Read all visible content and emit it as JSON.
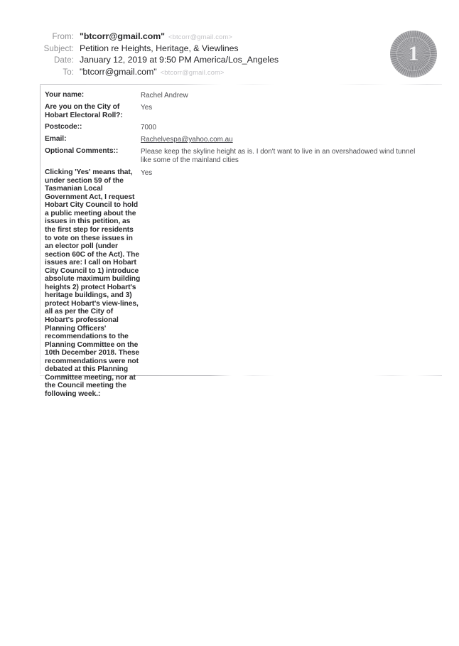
{
  "document": {
    "page_number": "1",
    "seal_name": "page-number-stamp"
  },
  "email_header": {
    "rows": [
      {
        "label": "From:",
        "value": "\"btcorr@gmail.com\"",
        "faint": "<btcorr@gmail.com>",
        "bold": true
      },
      {
        "label": "Subject:",
        "value": "Petition re Heights, Heritage, & Viewlines",
        "faint": "",
        "bold": false
      },
      {
        "label": "Date:",
        "value": "January 12, 2019 at 9:50 PM America/Los_Angeles",
        "faint": "",
        "bold": false
      },
      {
        "label": "To:",
        "value": "\"btcorr@gmail.com\"",
        "faint": "<btcorr@gmail.com>",
        "bold": false
      }
    ]
  },
  "form": {
    "fields": [
      {
        "label": "Your name:",
        "value": "Rachel Andrew",
        "is_link": false
      },
      {
        "label": "Are you on the City of Hobart Electoral Roll?:",
        "value": "Yes",
        "is_link": false
      },
      {
        "label": "Postcode::",
        "value": "7000",
        "is_link": false
      },
      {
        "label": "Email:",
        "value": "Rachelvespa@yahoo.com.au",
        "is_link": true
      },
      {
        "label": "Optional Comments::",
        "value": "Please keep the skyline height as is. I don't want to live in an overshadowed wind tunnel like some of the mainland cities",
        "is_link": false
      },
      {
        "label": "Clicking 'Yes' means that, under section 59 of the Tasmanian Local Government Act, I request Hobart City Council to hold a public meeting about the issues in this petition, as the first step for residents to vote on these issues in an elector poll (under section 60C of the Act). The issues are: I call on Hobart City Council to 1) introduce absolute maximum building heights 2) protect Hobart's heritage buildings, and 3) protect Hobart's view-lines, all as per the City of Hobart's professional Planning Officers' recommendations to the Planning Committee on the 10th December 2018. These recommendations were not debated at this Planning Committee meeting, nor at the Council meeting the following week.:",
        "value": "Yes",
        "is_link": false
      }
    ]
  }
}
